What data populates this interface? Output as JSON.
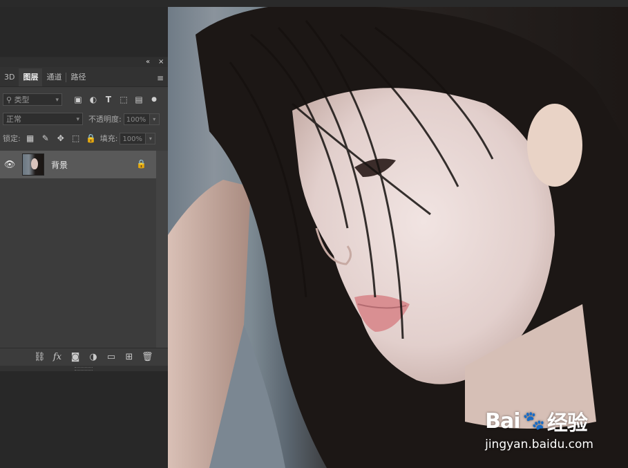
{
  "panel": {
    "header_controls": [
      "«",
      "×"
    ],
    "tabs": [
      "3D",
      "图层",
      "通道",
      "路径"
    ],
    "active_tab": "图层",
    "filter": {
      "value": "类型"
    },
    "blend_mode": {
      "value": "正常"
    },
    "opacity": {
      "label": "不透明度:",
      "value": "100%"
    },
    "lock": {
      "label": "锁定:"
    },
    "fill": {
      "label": "填充:",
      "value": "100%"
    },
    "layers": [
      {
        "name": "背景",
        "visible": true,
        "locked": true
      }
    ]
  },
  "watermark": {
    "brand": "Bai",
    "paw": "🐾",
    "brand_cn": "经验",
    "url": "jingyan.baidu.com"
  }
}
